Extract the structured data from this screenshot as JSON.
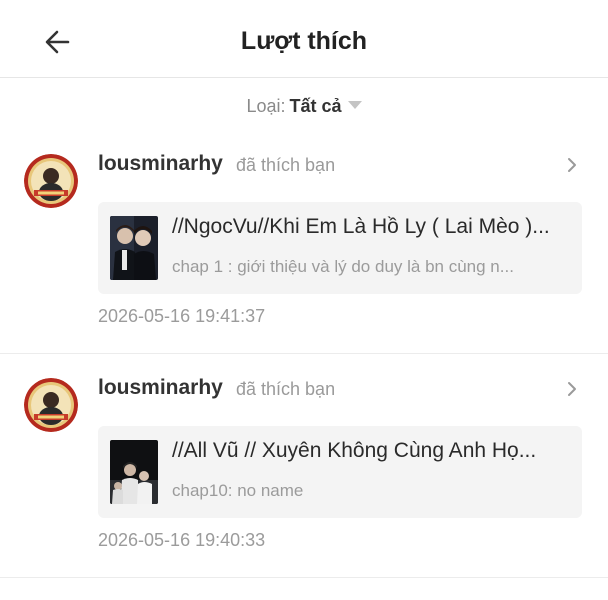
{
  "header": {
    "title": "Lượt thích",
    "back_icon": "arrow-left-icon"
  },
  "filter": {
    "label": "Loại:",
    "value": "Tất cả"
  },
  "notifications": [
    {
      "username": "lousminarhy",
      "action": "đã thích bạn",
      "story_title": "//NgocVu//Khi Em Là Hồ Ly ( Lai Mèo )...",
      "chapter": "chap 1 : giới thiệu và lý do duy là bn cùng n...",
      "timestamp": "2026-05-16 19:41:37"
    },
    {
      "username": "lousminarhy",
      "action": "đã thích bạn",
      "story_title": "//All Vũ // Xuyên Không Cùng Anh Họ...",
      "chapter": "chap10: no name",
      "timestamp": "2026-05-16 19:40:33"
    }
  ],
  "colors": {
    "background": "#ffffff",
    "card_background": "#f4f4f4",
    "muted_text": "#9b9b9b",
    "avatar_ring": "#b52a1e"
  }
}
